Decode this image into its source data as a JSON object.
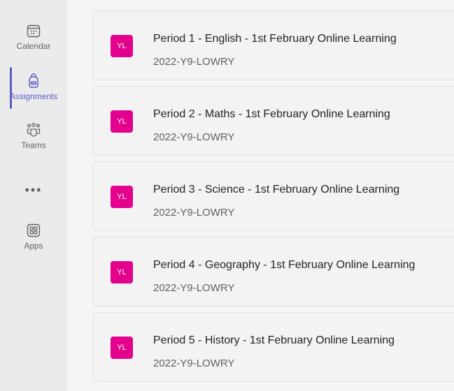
{
  "rail": {
    "items": [
      {
        "label": "Calendar",
        "icon": "calendar-icon"
      },
      {
        "label": "Assignments",
        "icon": "backpack-icon",
        "active": true
      },
      {
        "label": "Teams",
        "icon": "teams-icon"
      },
      {
        "label": "Apps",
        "icon": "apps-icon"
      }
    ],
    "more_label": "•••"
  },
  "assignments": [
    {
      "avatar": "YL",
      "title": "Period 1 - English - 1st February Online Learning",
      "class": "2022-Y9-LOWRY"
    },
    {
      "avatar": "YL",
      "title": "Period 2 - Maths - 1st February Online Learning",
      "class": "2022-Y9-LOWRY"
    },
    {
      "avatar": "YL",
      "title": "Period 3 - Science - 1st February Online Learning",
      "class": "2022-Y9-LOWRY"
    },
    {
      "avatar": "YL",
      "title": "Period 4 - Geography - 1st February Online Learning",
      "class": "2022-Y9-LOWRY"
    },
    {
      "avatar": "YL",
      "title": "Period 5 - History - 1st February Online Learning",
      "class": "2022-Y9-LOWRY"
    }
  ],
  "colors": {
    "accent": "#5b5fc7",
    "avatar": "#e3008c"
  }
}
